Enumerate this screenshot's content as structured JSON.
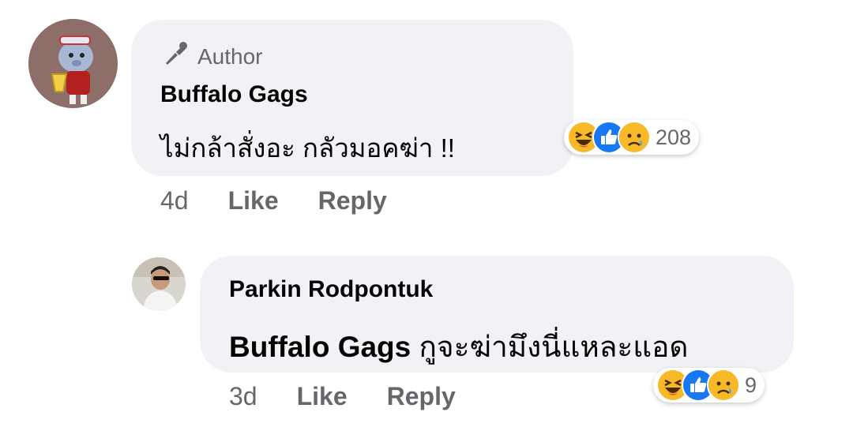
{
  "comment": {
    "author_badge": "Author",
    "name": "Buffalo Gags",
    "text": "ไม่กล้าสั่งอะ กลัวมอคฆ่า !!",
    "time": "4d",
    "like_label": "Like",
    "reply_label": "Reply",
    "reaction_count": "208",
    "reactions": [
      "haha-icon",
      "like-icon",
      "sad-icon"
    ]
  },
  "reply": {
    "name": "Parkin Rodpontuk",
    "mention": "Buffalo Gags",
    "text": " กูจะฆ่ามึงนี่แหละแอด",
    "time": "3d",
    "like_label": "Like",
    "reply_label": "Reply",
    "reaction_count": "9",
    "reactions": [
      "haha-icon",
      "like-icon",
      "sad-icon"
    ]
  },
  "colors": {
    "bubble": "#f0f2f5",
    "secondary_text": "#65676b",
    "like_blue": "#1877f2",
    "emoji_yellow": "#f7b928"
  }
}
